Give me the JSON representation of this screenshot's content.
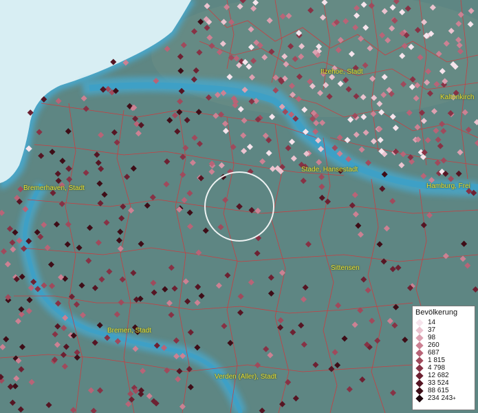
{
  "map": {
    "water_color": "#4a9cc0",
    "land_color": "#5e8683",
    "sea_color": "#d8eef3",
    "boundary_color": "#d4363a",
    "label_color": "#e8e23a",
    "selection_ring": "circle-selection-marker"
  },
  "place_labels": [
    {
      "name": "Itzehoe, Stadt"
    },
    {
      "name": "Kaltenkirch"
    },
    {
      "name": "Stade, Hansestadt"
    },
    {
      "name": "Hamburg, Frei"
    },
    {
      "name": "Bremerhaven, Stadt"
    },
    {
      "name": "Sittensen"
    },
    {
      "name": "Bremen, Stadt"
    },
    {
      "name": "Verden (Aller), Stadt"
    }
  ],
  "legend": {
    "title": "Bevölkerung",
    "classes": [
      {
        "label": "14",
        "color": "#f6e4ec"
      },
      {
        "label": "37",
        "color": "#ebc3cf"
      },
      {
        "label": "98",
        "color": "#dda1b1"
      },
      {
        "label": "260",
        "color": "#cc8193"
      },
      {
        "label": "687",
        "color": "#b86477"
      },
      {
        "label": "1 815",
        "color": "#a04a5c"
      },
      {
        "label": "4 798",
        "color": "#873245"
      },
      {
        "label": "12 682",
        "color": "#6d2132"
      },
      {
        "label": "33 524",
        "color": "#551523"
      },
      {
        "label": "88 615",
        "color": "#3e0d17"
      },
      {
        "label": "234 243",
        "color": "#1e060c",
        "plus": "+"
      }
    ]
  }
}
